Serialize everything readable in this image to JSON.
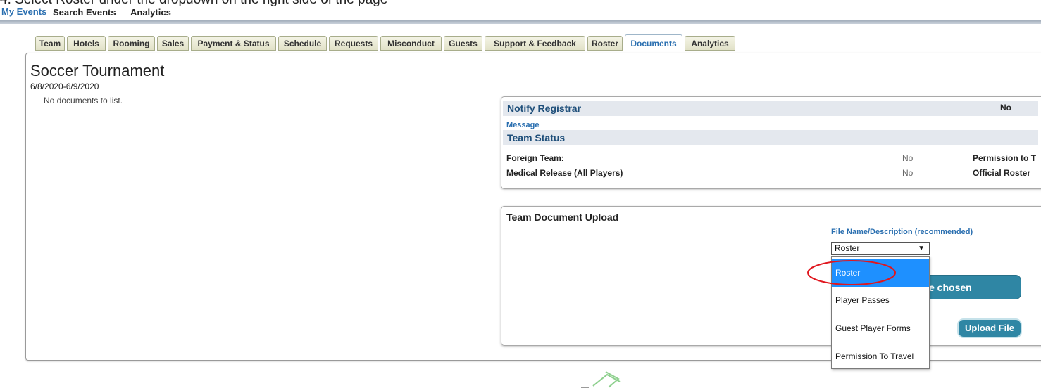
{
  "caption": "4. Select Roster under the dropdown on the right side of the page",
  "topnav": {
    "my_events": "My Events",
    "search_events": "Search Events",
    "analytics": "Analytics"
  },
  "tabs": [
    "Team",
    "Hotels",
    "Rooming",
    "Sales",
    "Payment & Status",
    "Schedule",
    "Requests",
    "Misconduct",
    "Guests",
    "Support & Feedback",
    "Roster",
    "Documents",
    "Analytics"
  ],
  "active_tab": "Documents",
  "event": {
    "title": "Soccer Tournament",
    "dates": "6/8/2020-6/9/2020",
    "no_documents": "No documents to list."
  },
  "notify": {
    "heading": "Notify Registrar",
    "value": "No",
    "message_link": "Message"
  },
  "team_status": {
    "heading": "Team Status",
    "rows": [
      {
        "label": "Foreign Team:",
        "value": "No",
        "right_label": "Permission to T"
      },
      {
        "label": "Medical Release (All Players)",
        "value": "No",
        "right_label": "Official Roster"
      }
    ]
  },
  "upload": {
    "title": "Team Document Upload",
    "file_label": "File Name/Description (recommended)",
    "selected": "Roster",
    "options": [
      "Roster",
      "Player Passes",
      "Guest Player Forms",
      "Permission To Travel"
    ],
    "choose_partial": "e chosen",
    "upload_button": "Upload File"
  },
  "colors": {
    "accent": "#2a6fb0",
    "button": "#2f86a4",
    "highlight": "#1e90ff",
    "annotation": "#e0161e"
  }
}
